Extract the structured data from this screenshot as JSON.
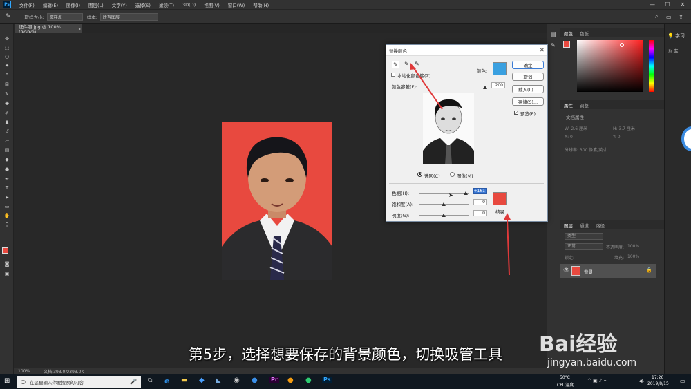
{
  "menubar": {
    "items": [
      "文件(F)",
      "编辑(E)",
      "图像(I)",
      "图层(L)",
      "文字(Y)",
      "选择(S)",
      "滤镜(T)",
      "3D(D)",
      "视图(V)",
      "窗口(W)",
      "帮助(H)"
    ],
    "minimize": "—",
    "maximize": "☐",
    "close": "✕"
  },
  "options": {
    "sample_size_label": "取样大小:",
    "sample_size_value": "取样点",
    "sample_label": "样本:",
    "sample_value": "所有图层"
  },
  "document_tab": {
    "label": "证件照.jpg @ 100%(RGB/8)",
    "close": "×"
  },
  "status": {
    "zoom": "100%",
    "doc": "文档:393.0K/393.0K"
  },
  "right_panel": {
    "color_tabs": [
      "颜色",
      "色板"
    ],
    "props_tabs": [
      "属性",
      "调整"
    ],
    "doc_props": "文档属性",
    "w": "W: 2.6 厘米",
    "h": "H: 3.7 厘米",
    "x": "X: 0",
    "y": "Y: 0",
    "resolution": "分辨率: 300 像素/英寸",
    "layers_tabs": [
      "图层",
      "通道",
      "路径"
    ],
    "kind_label": "类型",
    "blend_mode": "正常",
    "opacity_label": "不透明度:",
    "opacity_value": "100%",
    "lock_label": "锁定:",
    "fill_label": "填充:",
    "fill_value": "100%",
    "layer_name": "背景",
    "learn_label": "学习",
    "library_label": "库"
  },
  "dialog": {
    "title": "替换颜色",
    "localized_label": "本地化颜色簇(Z)",
    "color_label": "颜色:",
    "fuzziness_label": "颜色容差(F):",
    "fuzziness_value": "200",
    "selection_label": "选区(C)",
    "image_label": "图像(M)",
    "hue_label": "色相(H):",
    "hue_value": "+161",
    "saturation_label": "饱和度(A):",
    "saturation_value": "0",
    "lightness_label": "明度(G):",
    "lightness_value": "0",
    "result_label": "结果",
    "ok": "确定",
    "cancel": "取消",
    "load": "载入(L)...",
    "save": "存储(S)...",
    "preview": "预览(P)",
    "picked_color": "#3aa0e0",
    "result_color": "#e8493f"
  },
  "subtitle": "第5步，选择想要保存的背景颜色，切换吸管工具",
  "watermark": {
    "brand": "Bai经验",
    "url": "jingyan.baidu.com"
  },
  "taskbar": {
    "search_placeholder": "在这里输入你要搜索的内容",
    "weather": "50°C",
    "weather_label": "CPU温度",
    "time": "17:26",
    "date": "2019/8/15",
    "ime": "英"
  },
  "colors": {
    "accent": "#31a8ff",
    "photo_bg": "#e8493f",
    "arrow": "#e0393a"
  }
}
